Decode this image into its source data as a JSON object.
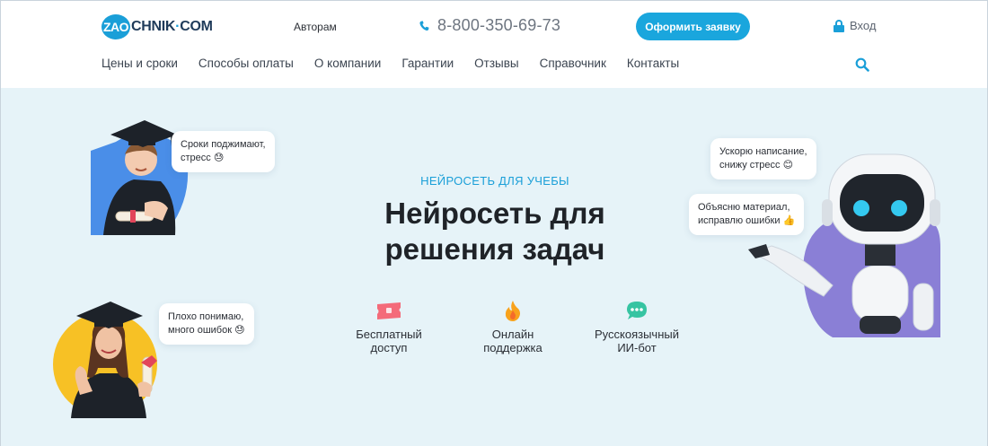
{
  "header": {
    "logo": {
      "badge": "ZAO",
      "rest": "CHNIK",
      "dot": "·",
      "tld": "COM"
    },
    "authors_link": "Авторам",
    "phone": "8-800-350-69-73",
    "order_button": "Оформить заявку",
    "login": "Вход",
    "nav": [
      "Цены и сроки",
      "Способы оплаты",
      "О компании",
      "Гарантии",
      "Отзывы",
      "Справочник",
      "Контакты"
    ],
    "icons": {
      "phone": "phone-icon",
      "login": "lock-icon",
      "search": "search-icon"
    }
  },
  "hero": {
    "eyebrow": "НЕЙРОСЕТЬ ДЛЯ УЧЕБЫ",
    "title_line1": "Нейросеть для",
    "title_line2": "решения задач",
    "features": [
      {
        "line1": "Бесплатный",
        "line2": "доступ",
        "icon": "ticket-icon"
      },
      {
        "line1": "Онлайн",
        "line2": "поддержка",
        "icon": "fire-icon"
      },
      {
        "line1": "Русскоязычный",
        "line2": "ИИ-бот",
        "icon": "chat-icon"
      }
    ],
    "bubbles": {
      "student_top_1": "Сроки поджимают,",
      "student_top_2": "стресс 😓",
      "student_bottom_1": "Плохо понимаю,",
      "student_bottom_2": "много ошибок 😓",
      "robot_top_1": "Ускорю написание,",
      "robot_top_2": "снижу стресс 😊",
      "robot_bottom_1": "Объясню материал,",
      "robot_bottom_2": "исправлю ошибки 👍"
    }
  },
  "colors": {
    "accent": "#1a9fd8",
    "hero_bg": "#e6f3f8",
    "robot_blob": "#8a7fd6",
    "student_blob_blue": "#4a8ee8",
    "student_blob_yellow": "#f7c125"
  }
}
